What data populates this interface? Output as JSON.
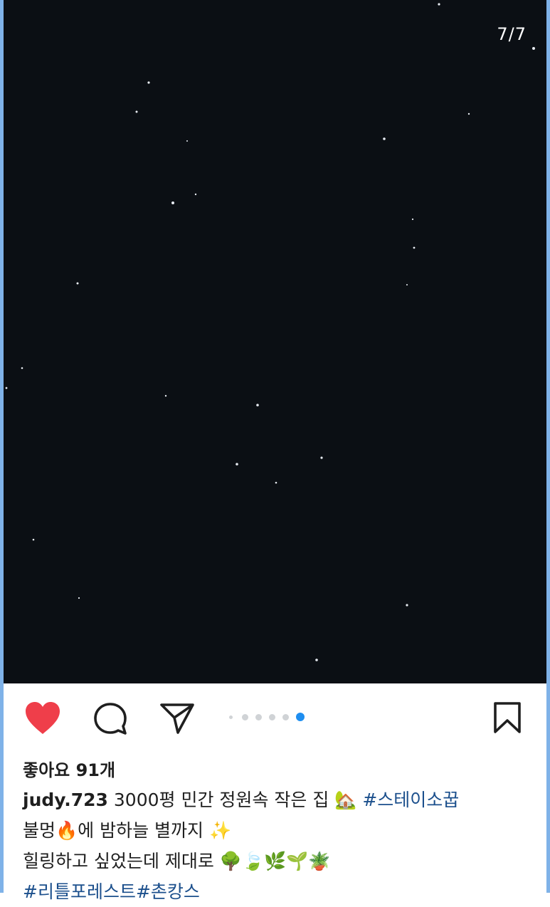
{
  "post": {
    "counter": "7/7",
    "likes": "좋아요 91개",
    "username": "judy.723",
    "caption_line1": "3000평 민간 정원속 작은 집 🏡",
    "hashtag1": "#스테이소꿉",
    "caption_line2": "불멍🔥에 밤하늘 별까지 ✨",
    "caption_line3": "힐링하고 싶었는데 제대로 🌳🍃🌿🌱🪴",
    "hashtag2": "#리틀포레스트",
    "hashtag3": "#촌캉스"
  },
  "icons": {
    "like": "heart-icon",
    "comment": "comment-icon",
    "share": "send-icon",
    "save": "bookmark-icon"
  },
  "carousel": {
    "total": 7,
    "active_index": 6
  },
  "colors": {
    "heart": "#ef3e4a",
    "active_dot": "#1e8ef0",
    "hashtag": "#1b4f8c",
    "frame": "#7fb2e8",
    "photo_bg": "#0b0f14"
  }
}
